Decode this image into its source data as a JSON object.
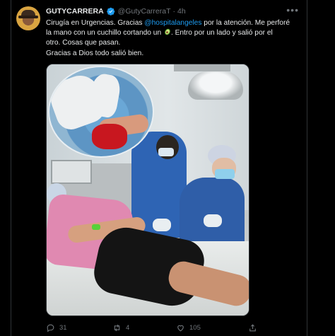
{
  "tweet": {
    "display_name": "GUTYCARRERA",
    "handle": "@GutyCarreraT",
    "separator": "·",
    "timestamp": "4h",
    "more_label": "•••",
    "text_lines": {
      "l1_a": "Cirugía en Urgencias. Gracias ",
      "l1_mention": "@hospitalangeles",
      "l1_b": " por la atención. Me perforé",
      "l2_a": "la mano con un cuchillo cortando un ",
      "l2_b": ". Entro por un lado y salió por el",
      "l3": "otro. Cosas que pasan.",
      "l4": "Gracias a Dios todo salió bien."
    }
  },
  "actions": {
    "reply_count": "31",
    "retweet_count": "4",
    "like_count": "105"
  },
  "colors": {
    "background": "#000000",
    "text": "#e7e9ea",
    "muted": "#71767b",
    "link": "#1d9bf0",
    "verified": "#1d9bf0"
  },
  "icons": [
    "verified-badge-icon",
    "more-icon",
    "avocado-emoji-icon",
    "reply-icon",
    "retweet-icon",
    "like-icon",
    "share-icon"
  ]
}
